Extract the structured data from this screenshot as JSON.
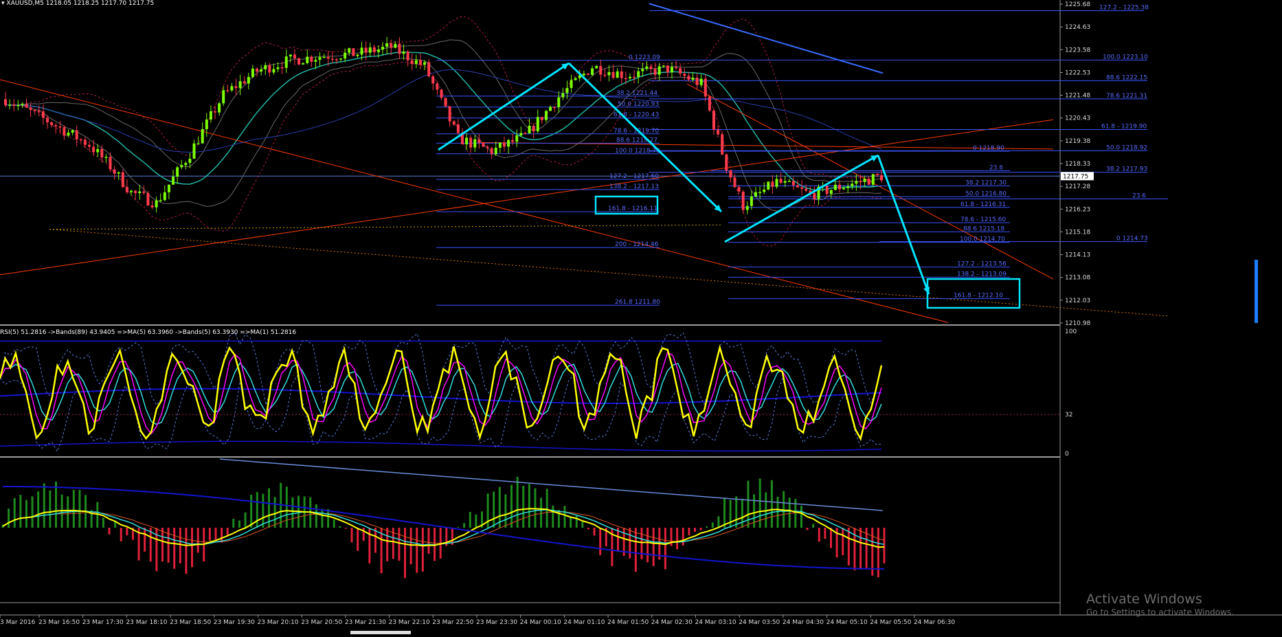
{
  "header": {
    "symbol": "XAUUSD,M5",
    "ohlc": "1218.05 1218.25 1217.70 1217.75"
  },
  "chart_data": [
    {
      "type": "line",
      "name": "price",
      "ylim": [
        1210.98,
        1225.68
      ],
      "y_ticks": [
        "1225.68",
        "1224.63",
        "1223.58",
        "1222.53",
        "1221.48",
        "1220.43",
        "1219.38",
        "1218.33",
        "1217.28",
        "1216.23",
        "1215.18",
        "1214.13",
        "1213.08",
        "1212.03",
        "1210.98"
      ],
      "current_price_label": "1217.75",
      "x_ticks": [
        "3 Mar 2016",
        "23 Mar 16:50",
        "23 Mar 17:30",
        "23 Mar 18:10",
        "23 Mar 18:50",
        "23 Mar 19:30",
        "23 Mar 20:10",
        "23 Mar 20:50",
        "23 Mar 21:30",
        "23 Mar 22:10",
        "23 Mar 22:50",
        "23 Mar 23:30",
        "24 Mar 00:10",
        "24 Mar 01:10",
        "24 Mar 01:50",
        "24 Mar 02:30",
        "24 Mar 03:10",
        "24 Mar 03:50",
        "24 Mar 04:30",
        "24 Mar 05:10",
        "24 Mar 05:50",
        "24 Mar 06:30"
      ],
      "fib_labels": [
        {
          "text": "127.2 - 1225.38",
          "price": 1225.38
        },
        {
          "text": "0 1223.09",
          "price": 1223.09
        },
        {
          "text": "100.0 1223.10",
          "price": 1223.1
        },
        {
          "text": "88.6 1222.15",
          "price": 1222.15
        },
        {
          "text": "38.2 1221.44",
          "price": 1221.44
        },
        {
          "text": "78.6 1221.31",
          "price": 1221.31
        },
        {
          "text": "50.0 1220.93",
          "price": 1220.93
        },
        {
          "text": "61.8 - 1220.43",
          "price": 1220.43
        },
        {
          "text": "61.8 - 1219.90",
          "price": 1219.9
        },
        {
          "text": "78.6 - 1219.70",
          "price": 1219.7
        },
        {
          "text": "88.6 1219.27",
          "price": 1219.27
        },
        {
          "text": "0 1218.90",
          "price": 1218.9
        },
        {
          "text": "50.0 1218.92",
          "price": 1218.92
        },
        {
          "text": "100.0 1218.78",
          "price": 1218.78
        },
        {
          "text": "23.6",
          "price": 1218.0
        },
        {
          "text": "38.2 1217.93",
          "price": 1217.93
        },
        {
          "text": "127.2 - 1217.60",
          "price": 1217.6
        },
        {
          "text": "38.2 1217.30",
          "price": 1217.3
        },
        {
          "text": "138.2 - 1217.13",
          "price": 1217.13
        },
        {
          "text": "50.0 1216.80",
          "price": 1216.8
        },
        {
          "text": "23.6",
          "price": 1216.7
        },
        {
          "text": "61.8 - 1216.31",
          "price": 1216.31
        },
        {
          "text": "161.8 - 1216.11",
          "price": 1216.11
        },
        {
          "text": "78.6 - 1215.60",
          "price": 1215.6
        },
        {
          "text": "88.6 1215.18",
          "price": 1215.18
        },
        {
          "text": "100.0 1214.70",
          "price": 1214.7
        },
        {
          "text": "0 1214.73",
          "price": 1214.73
        },
        {
          "text": "200 - 1214.46",
          "price": 1214.46
        },
        {
          "text": "127.2 - 1213.56",
          "price": 1213.56
        },
        {
          "text": "138.2 - 1213.09",
          "price": 1213.09
        },
        {
          "text": "161.8 - 1212.10",
          "price": 1212.1
        },
        {
          "text": "261.8 1211.80",
          "price": 1211.8
        }
      ]
    },
    {
      "type": "line",
      "name": "RSI",
      "header": "RSI(5) 51.2816  ->Bands(89) 43.9405  =>MA(5) 63.3960  ->Bands(5) 63.3930  =>MA(1) 51.2816",
      "ylim": [
        0,
        100
      ],
      "y_ticks": [
        "100",
        "32",
        "0"
      ]
    },
    {
      "type": "bar",
      "name": "oscillator-histogram"
    }
  ],
  "watermark": {
    "title": "Activate Windows",
    "subtitle": "Go to Settings to activate Windows."
  },
  "colors": {
    "background": "#000000",
    "bull_candle": "#7cfc00",
    "bear_candle": "#ff3b4e",
    "fib_line": "#3a55ff",
    "fib_text": "#5a6cff",
    "arrow": "#00e5ff",
    "trendline": "#ff3b00",
    "rsi_line": "#ffff00",
    "ma_magenta": "#ff00ff",
    "ma_cyan": "#33e0e0",
    "band_blue": "#1414d0",
    "hist_green": "#1d8a1d",
    "hist_red": "#e0203a"
  }
}
